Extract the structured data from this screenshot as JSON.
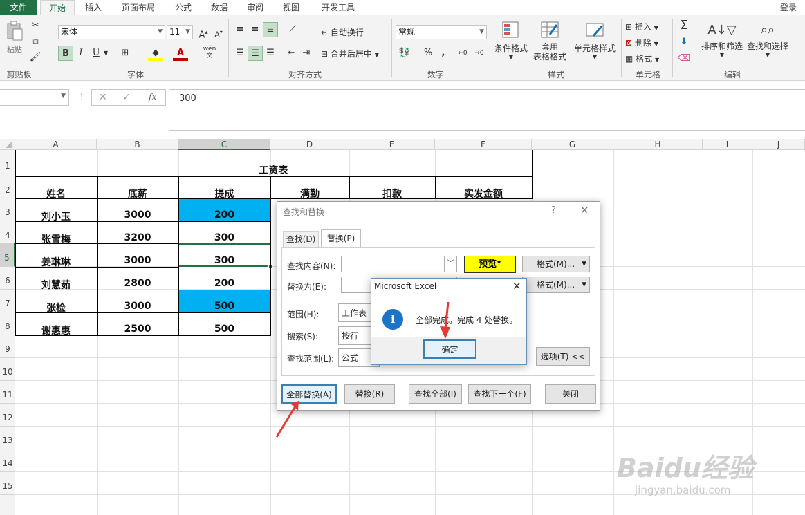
{
  "tabs": {
    "file": "文件",
    "home": "开始",
    "insert": "插入",
    "layout": "页面布局",
    "formula": "公式",
    "data": "数据",
    "review": "审阅",
    "view": "视图",
    "developer": "开发工具",
    "login": "登录"
  },
  "ribbon": {
    "clipboard": {
      "paste": "粘贴",
      "label": "剪贴板"
    },
    "font": {
      "name": "宋体",
      "size": "11",
      "bold": "B",
      "italic": "I",
      "underline": "U",
      "label": "字体"
    },
    "align": {
      "wrap": "自动换行",
      "merge": "合并后居中",
      "label": "对齐方式"
    },
    "number": {
      "format": "常规",
      "percent": "%",
      "comma": ",",
      "label": "数字"
    },
    "styles": {
      "cond": "条件格式",
      "table_line1": "套用",
      "table_line2": "表格格式",
      "cell": "单元格样式",
      "label": "样式"
    },
    "cells": {
      "insert": "插入",
      "delete": "删除",
      "format": "格式",
      "label": "单元格"
    },
    "edit": {
      "sort": "排序和筛选",
      "find": "查找和选择",
      "label": "编辑"
    }
  },
  "formula_bar": {
    "value": "300",
    "fx": "fx"
  },
  "columns": [
    "A",
    "B",
    "C",
    "D",
    "E",
    "F",
    "G",
    "H",
    "I",
    "J"
  ],
  "rows": [
    "1",
    "2",
    "3",
    "4",
    "5",
    "6",
    "7",
    "8",
    "9",
    "10",
    "11",
    "12",
    "13",
    "14",
    "15"
  ],
  "sheet": {
    "title": "工资表",
    "headers": [
      "姓名",
      "底薪",
      "提成",
      "满勤",
      "扣款",
      "实发金额"
    ],
    "data": [
      {
        "name": "刘小玉",
        "base": "3000",
        "bonus": "200",
        "hl": true
      },
      {
        "name": "张雪梅",
        "base": "3200",
        "bonus": "300",
        "hl": false
      },
      {
        "name": "姜琳琳",
        "base": "3000",
        "bonus": "300",
        "hl": false
      },
      {
        "name": "刘慧茹",
        "base": "2800",
        "bonus": "200",
        "hl": false
      },
      {
        "name": "张检",
        "base": "3000",
        "bonus": "500",
        "hl": true
      },
      {
        "name": "谢惠惠",
        "base": "2500",
        "bonus": "500",
        "hl": false
      }
    ],
    "highlight_color": "#00b0f0"
  },
  "find_dialog": {
    "title": "查找和替换",
    "help": "?",
    "tab_find": "查找(D)",
    "tab_replace": "替换(P)",
    "find_label": "查找内容(N):",
    "replace_label": "替换为(E):",
    "preview": "预览*",
    "format_btn": "格式(M)...",
    "scope_label": "范围(H):",
    "scope_value": "工作表",
    "search_label": "搜索(S):",
    "search_value": "按行",
    "lookin_label": "查找范围(L):",
    "lookin_value": "公式",
    "options_btn": "选项(T) <<",
    "replace_all": "全部替换(A)",
    "replace": "替换(R)",
    "find_all": "查找全部(I)",
    "find_next": "查找下一个(F)",
    "close": "关闭"
  },
  "msgbox": {
    "title": "Microsoft Excel",
    "text": "全部完成。完成 4 处替换。",
    "ok": "确定"
  },
  "watermark": {
    "brand": "Baidu经验",
    "url": "jingyan.baidu.com"
  }
}
